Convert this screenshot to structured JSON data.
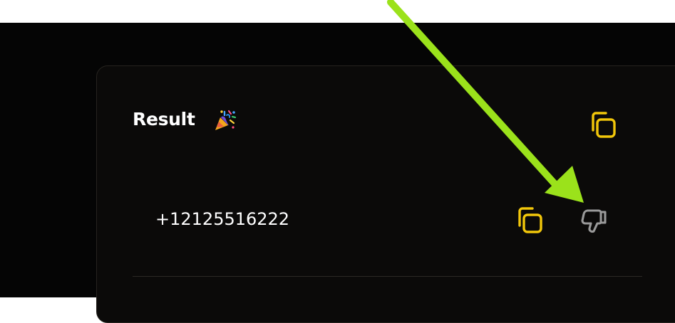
{
  "card": {
    "title": "Result",
    "title_emoji": "party-popper-icon"
  },
  "result": {
    "phone_number": "+12125516222"
  },
  "icons": {
    "copy_all": "copy-icon",
    "copy_row": "copy-icon",
    "feedback": "thumbs-down-icon"
  },
  "colors": {
    "background": "#050505",
    "card": "#0b0a09",
    "text": "#ffffff",
    "copy_icon": "#f2c70a",
    "thumbs_icon": "#9a9a9a",
    "annotation_arrow": "#9be21b"
  }
}
